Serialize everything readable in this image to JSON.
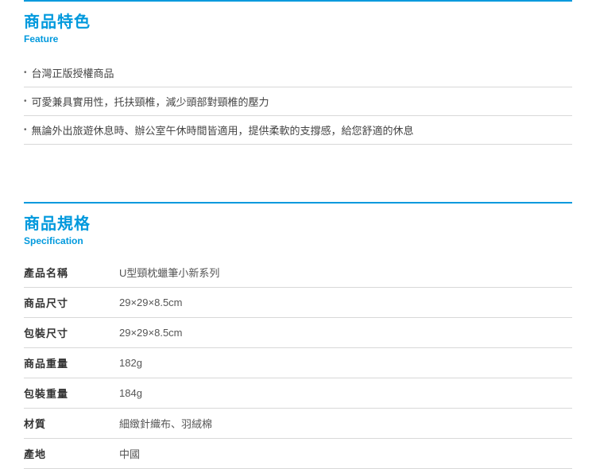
{
  "feature": {
    "title_zh": "商品特色",
    "title_en": "Feature",
    "items": [
      "台灣正版授權商品",
      "可愛兼具實用性，托扶頸椎，減少頭部對頸椎的壓力",
      "無論外出旅遊休息時、辦公室午休時間皆適用，提供柔軟的支撐感，給您舒適的休息"
    ]
  },
  "spec": {
    "title_zh": "商品規格",
    "title_en": "Specification",
    "rows": [
      {
        "label": "產品名稱",
        "value": "U型頸枕蠟筆小新系列"
      },
      {
        "label": "商品尺寸",
        "value": "29×29×8.5cm"
      },
      {
        "label": "包裝尺寸",
        "value": "29×29×8.5cm"
      },
      {
        "label": "商品重量",
        "value": "182g"
      },
      {
        "label": "包裝重量",
        "value": "184g"
      },
      {
        "label": "材質",
        "value": "細緻針織布、羽絨棉"
      },
      {
        "label": "產地",
        "value": "中國"
      }
    ]
  }
}
